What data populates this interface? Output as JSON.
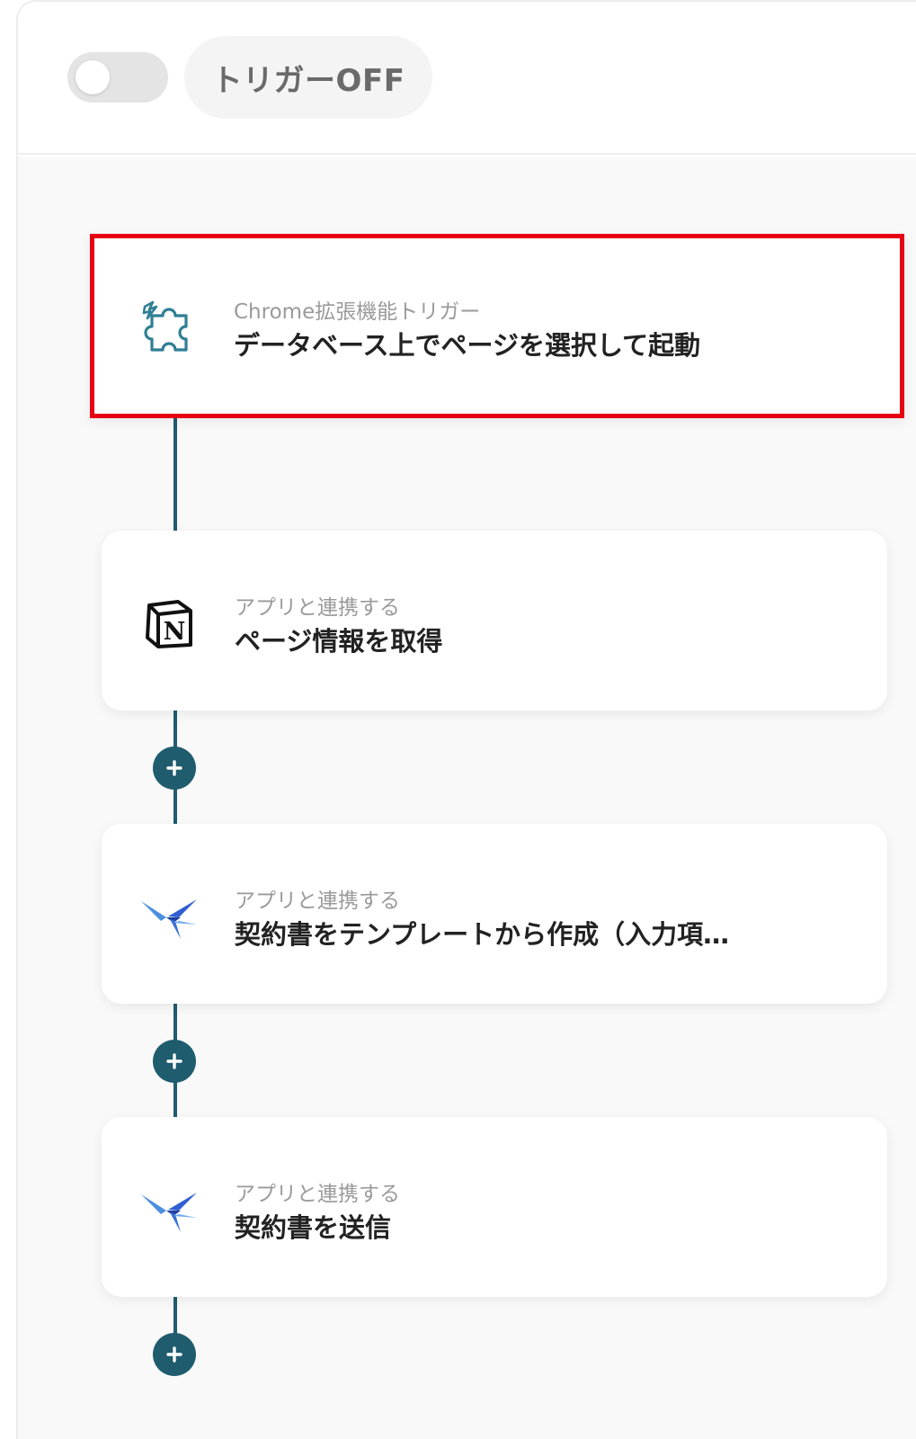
{
  "header": {
    "trigger_toggle_state": "off",
    "trigger_status_label": "トリガーOFF"
  },
  "flow": {
    "steps": [
      {
        "icon": "chrome-extension-puzzle-icon",
        "subtitle": "Chrome拡張機能トリガー",
        "title": "データベース上でページを選択して起動",
        "highlighted": true
      },
      {
        "icon": "notion-logo-icon",
        "subtitle": "アプリと連携する",
        "title": "ページ情報を取得",
        "highlighted": false
      },
      {
        "icon": "contract-app-bird-icon",
        "subtitle": "アプリと連携する",
        "title": "契約書をテンプレートから作成（入力項…",
        "highlighted": false
      },
      {
        "icon": "contract-app-bird-icon",
        "subtitle": "アプリと連携する",
        "title": "契約書を送信",
        "highlighted": false
      }
    ],
    "add_step_buttons": 3
  },
  "colors": {
    "accent": "#1f5c6e",
    "highlight_border": "#e60012",
    "canvas_bg": "#f9f9f9"
  }
}
